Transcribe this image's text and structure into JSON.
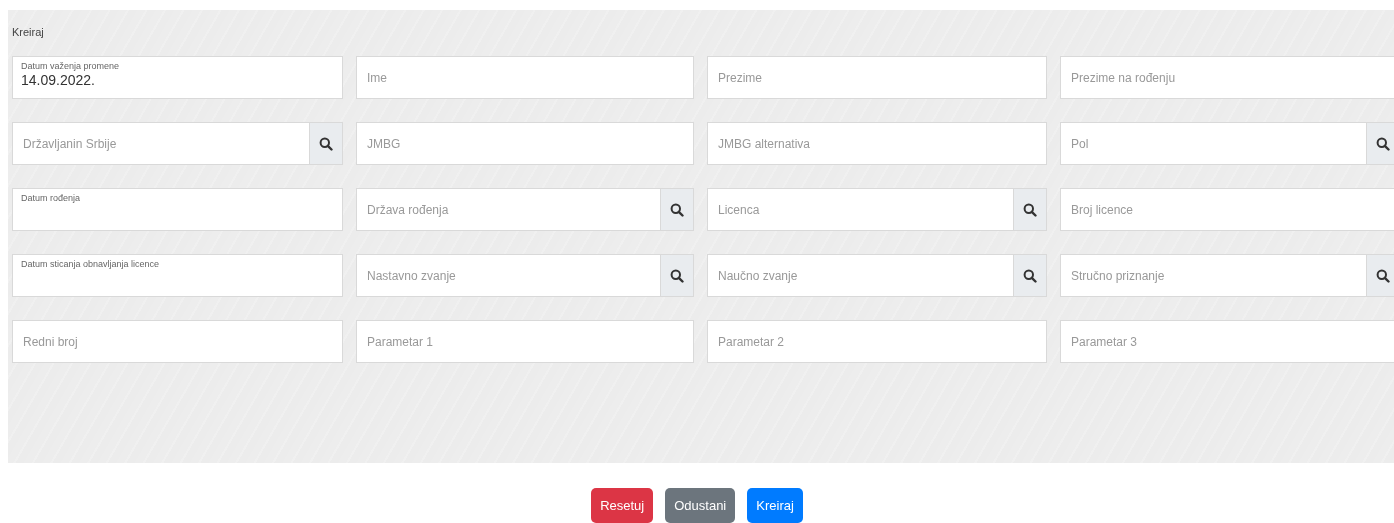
{
  "panel": {
    "title": "Kreiraj"
  },
  "fields": [
    {
      "kind": "floating",
      "label": "Datum važenja promene",
      "value": "14.09.2022."
    },
    {
      "kind": "plain",
      "placeholder": "Ime"
    },
    {
      "kind": "plain",
      "placeholder": "Prezime"
    },
    {
      "kind": "plain",
      "placeholder": "Prezime na rođenju"
    },
    {
      "kind": "lookup",
      "placeholder": "Državljanin Srbije"
    },
    {
      "kind": "plain",
      "placeholder": "JMBG"
    },
    {
      "kind": "plain",
      "placeholder": "JMBG alternativa"
    },
    {
      "kind": "lookup",
      "placeholder": "Pol"
    },
    {
      "kind": "floating",
      "label": "Datum rođenja"
    },
    {
      "kind": "lookup",
      "placeholder": "Država rođenja"
    },
    {
      "kind": "lookup",
      "placeholder": "Licenca"
    },
    {
      "kind": "plain",
      "placeholder": "Broj licence"
    },
    {
      "kind": "floating",
      "label": "Datum sticanja obnavljanja licence"
    },
    {
      "kind": "lookup",
      "placeholder": "Nastavno zvanje"
    },
    {
      "kind": "lookup",
      "placeholder": "Naučno zvanje"
    },
    {
      "kind": "lookup",
      "placeholder": "Stručno priznanje"
    },
    {
      "kind": "plain",
      "placeholder": "Redni broj"
    },
    {
      "kind": "plain",
      "placeholder": "Parametar 1"
    },
    {
      "kind": "plain",
      "placeholder": "Parametar 2"
    },
    {
      "kind": "plain",
      "placeholder": "Parametar 3"
    }
  ],
  "buttons": [
    {
      "label": "Resetuj",
      "kind": "reset"
    },
    {
      "label": "Odustani",
      "kind": "cancel"
    },
    {
      "label": "Kreiraj",
      "kind": "submit"
    }
  ]
}
